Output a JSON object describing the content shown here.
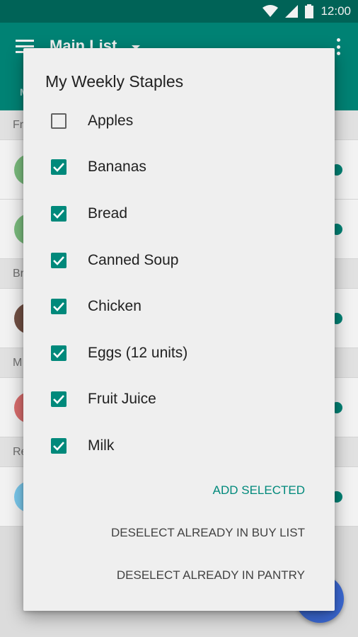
{
  "status_bar": {
    "time": "12:00",
    "icons": [
      "wifi-icon",
      "cell-signal-icon",
      "battery-icon"
    ]
  },
  "app_bar": {
    "title": "Main List",
    "tab_stub": "M"
  },
  "background_list": {
    "sections": [
      {
        "header": "Fr",
        "rows": [
          {
            "avatar_color": "#81c784"
          },
          {
            "avatar_color": "#81c784"
          }
        ]
      },
      {
        "header": "Br",
        "rows": [
          {
            "avatar_color": "#795548"
          }
        ]
      },
      {
        "header": "M",
        "rows": [
          {
            "avatar_color": "#e57373"
          }
        ]
      },
      {
        "header": "Re",
        "rows": [
          {
            "avatar_color": "#81d4fa"
          }
        ]
      }
    ]
  },
  "dialog": {
    "title": "My Weekly Staples",
    "items": [
      {
        "label": "Apples",
        "checked": false
      },
      {
        "label": "Bananas",
        "checked": true
      },
      {
        "label": "Bread",
        "checked": true
      },
      {
        "label": "Canned Soup",
        "checked": true
      },
      {
        "label": "Chicken",
        "checked": true
      },
      {
        "label": "Eggs (12 units)",
        "checked": true
      },
      {
        "label": "Fruit Juice",
        "checked": true
      },
      {
        "label": "Milk",
        "checked": true
      }
    ],
    "actions": {
      "add_selected": "ADD SELECTED",
      "deselect_buy_list": "DESELECT ALREADY IN BUY LIST",
      "deselect_pantry": "DESELECT ALREADY IN PANTRY"
    }
  },
  "colors": {
    "primary": "#00897b",
    "primary_dark": "#00695c",
    "fab": "#3f6fe0"
  }
}
